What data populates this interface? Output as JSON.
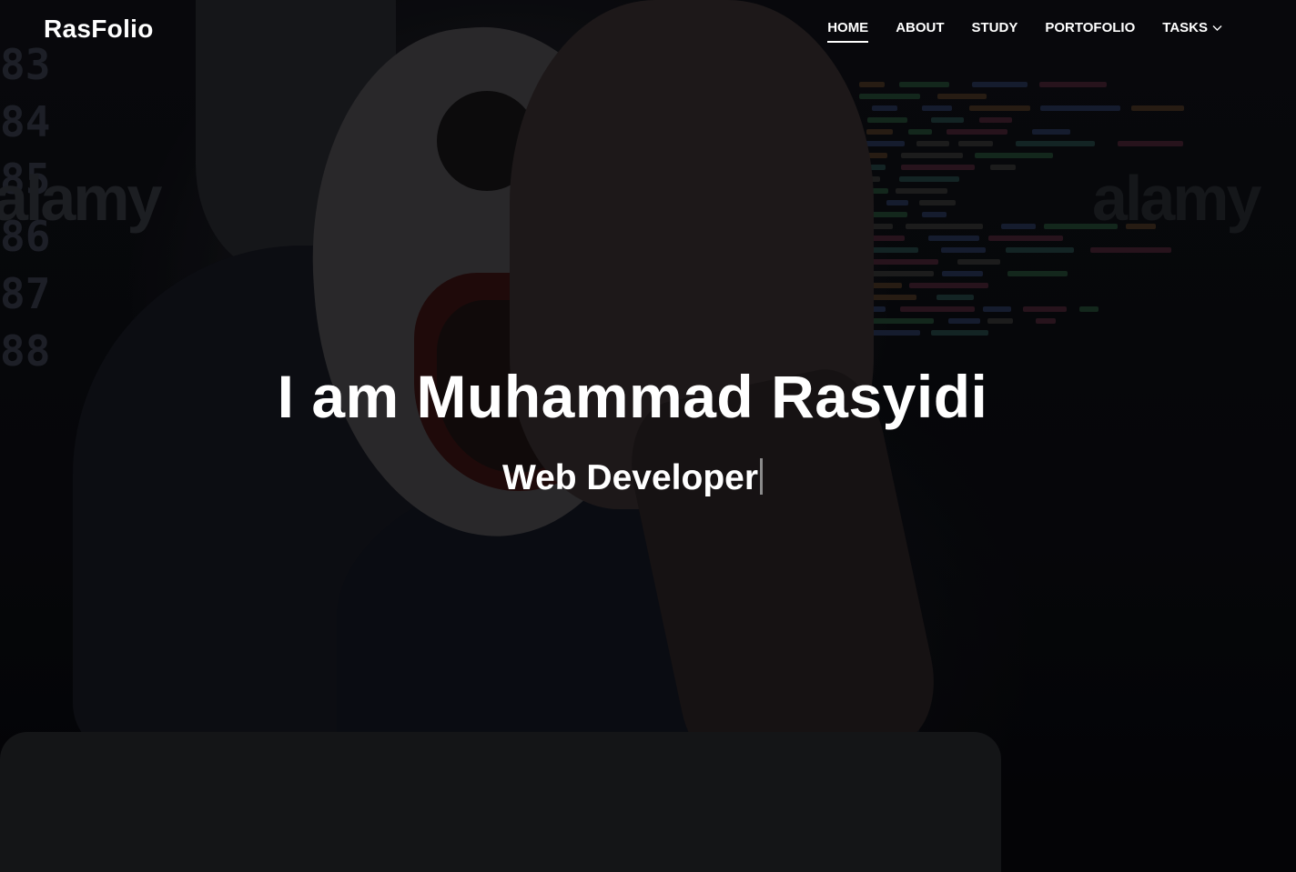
{
  "brand": {
    "logo": "RasFolio"
  },
  "nav": {
    "items": [
      {
        "label": "HOME",
        "active": true
      },
      {
        "label": "ABOUT"
      },
      {
        "label": "STUDY"
      },
      {
        "label": "PORTOFOLIO"
      },
      {
        "label": "TASKS",
        "icon": "chevron-down-icon"
      }
    ]
  },
  "hero": {
    "title": "I am Muhammad Rasyidi",
    "subtitle": "Web Developer",
    "background_watermark": "alamy"
  },
  "colors": {
    "text": "#ffffff",
    "background": "#07080c",
    "cursor": "#8a8a8a"
  }
}
